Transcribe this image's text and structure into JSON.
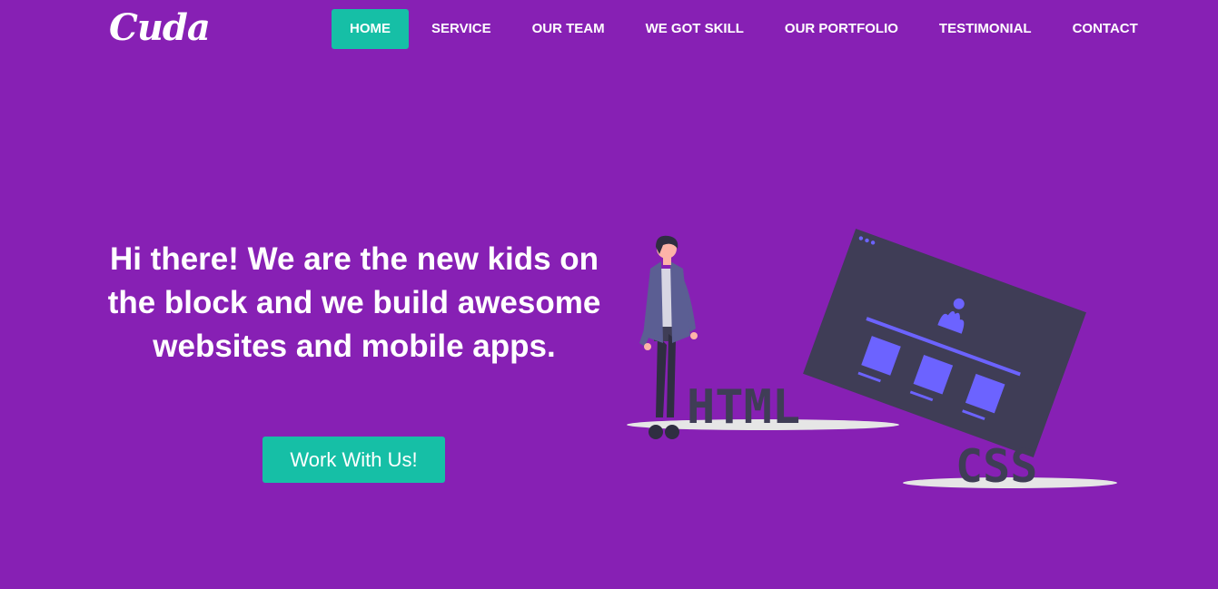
{
  "brand": {
    "logo_text": "Cuda"
  },
  "nav": {
    "items": [
      {
        "label": "HOME",
        "active": true
      },
      {
        "label": "SERVICE",
        "active": false
      },
      {
        "label": "OUR TEAM",
        "active": false
      },
      {
        "label": "WE GOT SKILL",
        "active": false
      },
      {
        "label": "OUR PORTFOLIO",
        "active": false
      },
      {
        "label": "TESTIMONIAL",
        "active": false
      },
      {
        "label": "CONTACT",
        "active": false
      }
    ]
  },
  "hero": {
    "title": "Hi there! We are the new kids on the block and we build awesome websites and mobile apps.",
    "cta_label": "Work With Us!"
  },
  "illustration": {
    "html_label": "HTML",
    "css_label": "CSS"
  },
  "colors": {
    "background": "#8720b4",
    "accent": "#16bfa6",
    "illustration_dark": "#3f3d56",
    "illustration_highlight": "#6c63ff",
    "shadow": "#e6e6e6"
  }
}
